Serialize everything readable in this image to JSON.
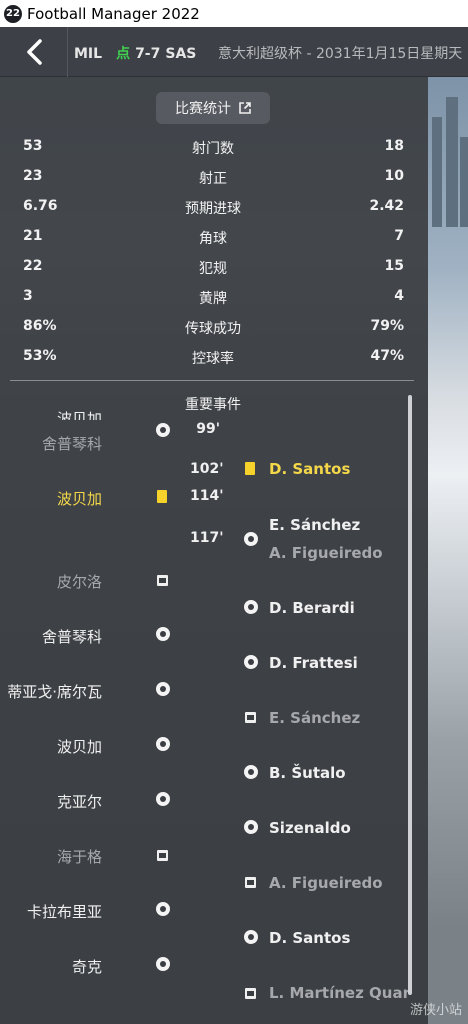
{
  "window": {
    "app_logo": "22",
    "title": "Football Manager 2022"
  },
  "header": {
    "home": "MIL",
    "penalty_marker": "点",
    "score": "7-7",
    "away": "SAS",
    "competition": "意大利超级杯 - 2031年1月15日星期天"
  },
  "stats_button": {
    "label": "比赛统计"
  },
  "stats": [
    {
      "home": "53",
      "label": "射门数",
      "away": "18"
    },
    {
      "home": "23",
      "label": "射正",
      "away": "10"
    },
    {
      "home": "6.76",
      "label": "预期进球",
      "away": "2.42"
    },
    {
      "home": "21",
      "label": "角球",
      "away": "7"
    },
    {
      "home": "22",
      "label": "犯规",
      "away": "15"
    },
    {
      "home": "3",
      "label": "黄牌",
      "away": "4"
    },
    {
      "home": "86%",
      "label": "传球成功",
      "away": "79%"
    },
    {
      "home": "53%",
      "label": "控球率",
      "away": "47%"
    }
  ],
  "events_title": "重要事件",
  "events": {
    "partial_top": "波贝加",
    "e1_sub": "舍普琴科",
    "e1_min": "99'",
    "e2_min": "102'",
    "e2_player": "D. Santos",
    "e3_player": "波贝加",
    "e3_min": "114'",
    "e4_min": "117'",
    "e4_player": "E. Sánchez",
    "e4_sub": "A. Figueiredo",
    "pens": [
      {
        "side": "home",
        "player": "皮尔洛",
        "result": "miss"
      },
      {
        "side": "away",
        "player": "D. Berardi",
        "result": "goal"
      },
      {
        "side": "home",
        "player": "舍普琴科",
        "result": "goal"
      },
      {
        "side": "away",
        "player": "D. Frattesi",
        "result": "goal"
      },
      {
        "side": "home",
        "player": "蒂亚戈·席尔瓦",
        "result": "goal"
      },
      {
        "side": "away",
        "player": "E. Sánchez",
        "result": "miss"
      },
      {
        "side": "home",
        "player": "波贝加",
        "result": "goal"
      },
      {
        "side": "away",
        "player": "B. Šutalo",
        "result": "goal"
      },
      {
        "side": "home",
        "player": "克亚尔",
        "result": "goal"
      },
      {
        "side": "away",
        "player": "Sizenaldo",
        "result": "goal"
      },
      {
        "side": "home",
        "player": "海于格",
        "result": "miss"
      },
      {
        "side": "away",
        "player": "A. Figueiredo",
        "result": "miss"
      },
      {
        "side": "home",
        "player": "卡拉布里亚",
        "result": "goal"
      },
      {
        "side": "away",
        "player": "D. Santos",
        "result": "goal"
      },
      {
        "side": "home",
        "player": "奇克",
        "result": "goal"
      },
      {
        "side": "away",
        "player": "L. Martínez Quar",
        "result": "miss"
      }
    ]
  },
  "watermark": "游侠小站",
  "colors": {
    "accent_green": "#3fd14f",
    "yellow_card": "#f6d22a",
    "highlight_text": "#f4d84a"
  },
  "icons": [
    "back-chevron-icon",
    "external-link-icon",
    "football-icon",
    "yellow-card-icon",
    "missed-penalty-icon"
  ]
}
